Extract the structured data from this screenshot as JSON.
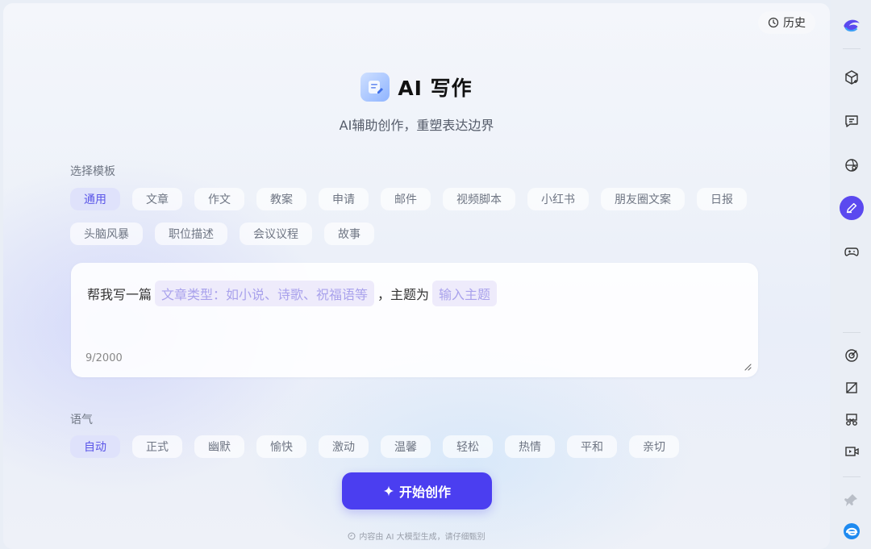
{
  "header": {
    "history_label": "历史"
  },
  "hero": {
    "title": "AI 写作",
    "subtitle": "AI辅助创作，重塑表达边界"
  },
  "templates": {
    "label": "选择模板",
    "items": [
      "通用",
      "文章",
      "作文",
      "教案",
      "申请",
      "邮件",
      "视频脚本",
      "小红书",
      "朋友圈文案",
      "日报",
      "头脑风暴",
      "职位描述",
      "会议议程",
      "故事"
    ],
    "active": "通用"
  },
  "editor": {
    "prefix": "帮我写一篇",
    "slot1": "文章类型：如小说、诗歌、祝福语等",
    "middle": "，主题为",
    "slot2": "输入主题",
    "counter": "9/2000"
  },
  "tone": {
    "label": "语气",
    "items": [
      "自动",
      "正式",
      "幽默",
      "愉快",
      "激动",
      "温馨",
      "轻松",
      "热情",
      "平和",
      "亲切"
    ],
    "active": "自动"
  },
  "start_button": {
    "label": "开始创作"
  },
  "footer": {
    "text": "内容由 AI 大模型生成，请仔细甄别"
  },
  "sidebar": {
    "icons": [
      "brand-logo-icon",
      "cube-plus-icon",
      "chat-icon",
      "globe-search-icon",
      "pen-icon",
      "gamepad-icon",
      "target-icon",
      "crop-icon",
      "scissors-icon",
      "video-icon",
      "pin-icon",
      "browser-logo-icon"
    ],
    "active": "pen-icon"
  },
  "colors": {
    "accent": "#4b3ef0",
    "chip_active_bg": "#dfe2fb",
    "chip_active_text": "#5b56e8"
  }
}
